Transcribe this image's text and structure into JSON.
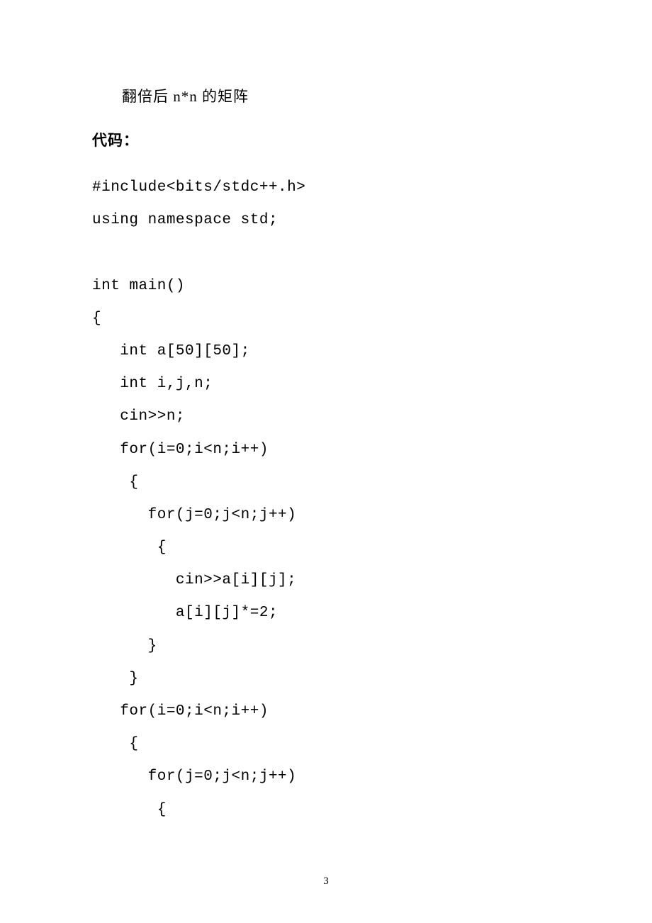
{
  "description": "翻倍后 n*n 的矩阵",
  "codeLabel": "代码：",
  "code": "#include<bits/stdc++.h>\nusing namespace std;\n\nint main()\n{\n   int a[50][50];\n   int i,j,n;\n   cin>>n;\n   for(i=0;i<n;i++)\n    {\n      for(j=0;j<n;j++)\n       {\n         cin>>a[i][j];\n         a[i][j]*=2;\n      }\n    }\n   for(i=0;i<n;i++)\n    {\n      for(j=0;j<n;j++)\n       {",
  "pageNumber": "3"
}
